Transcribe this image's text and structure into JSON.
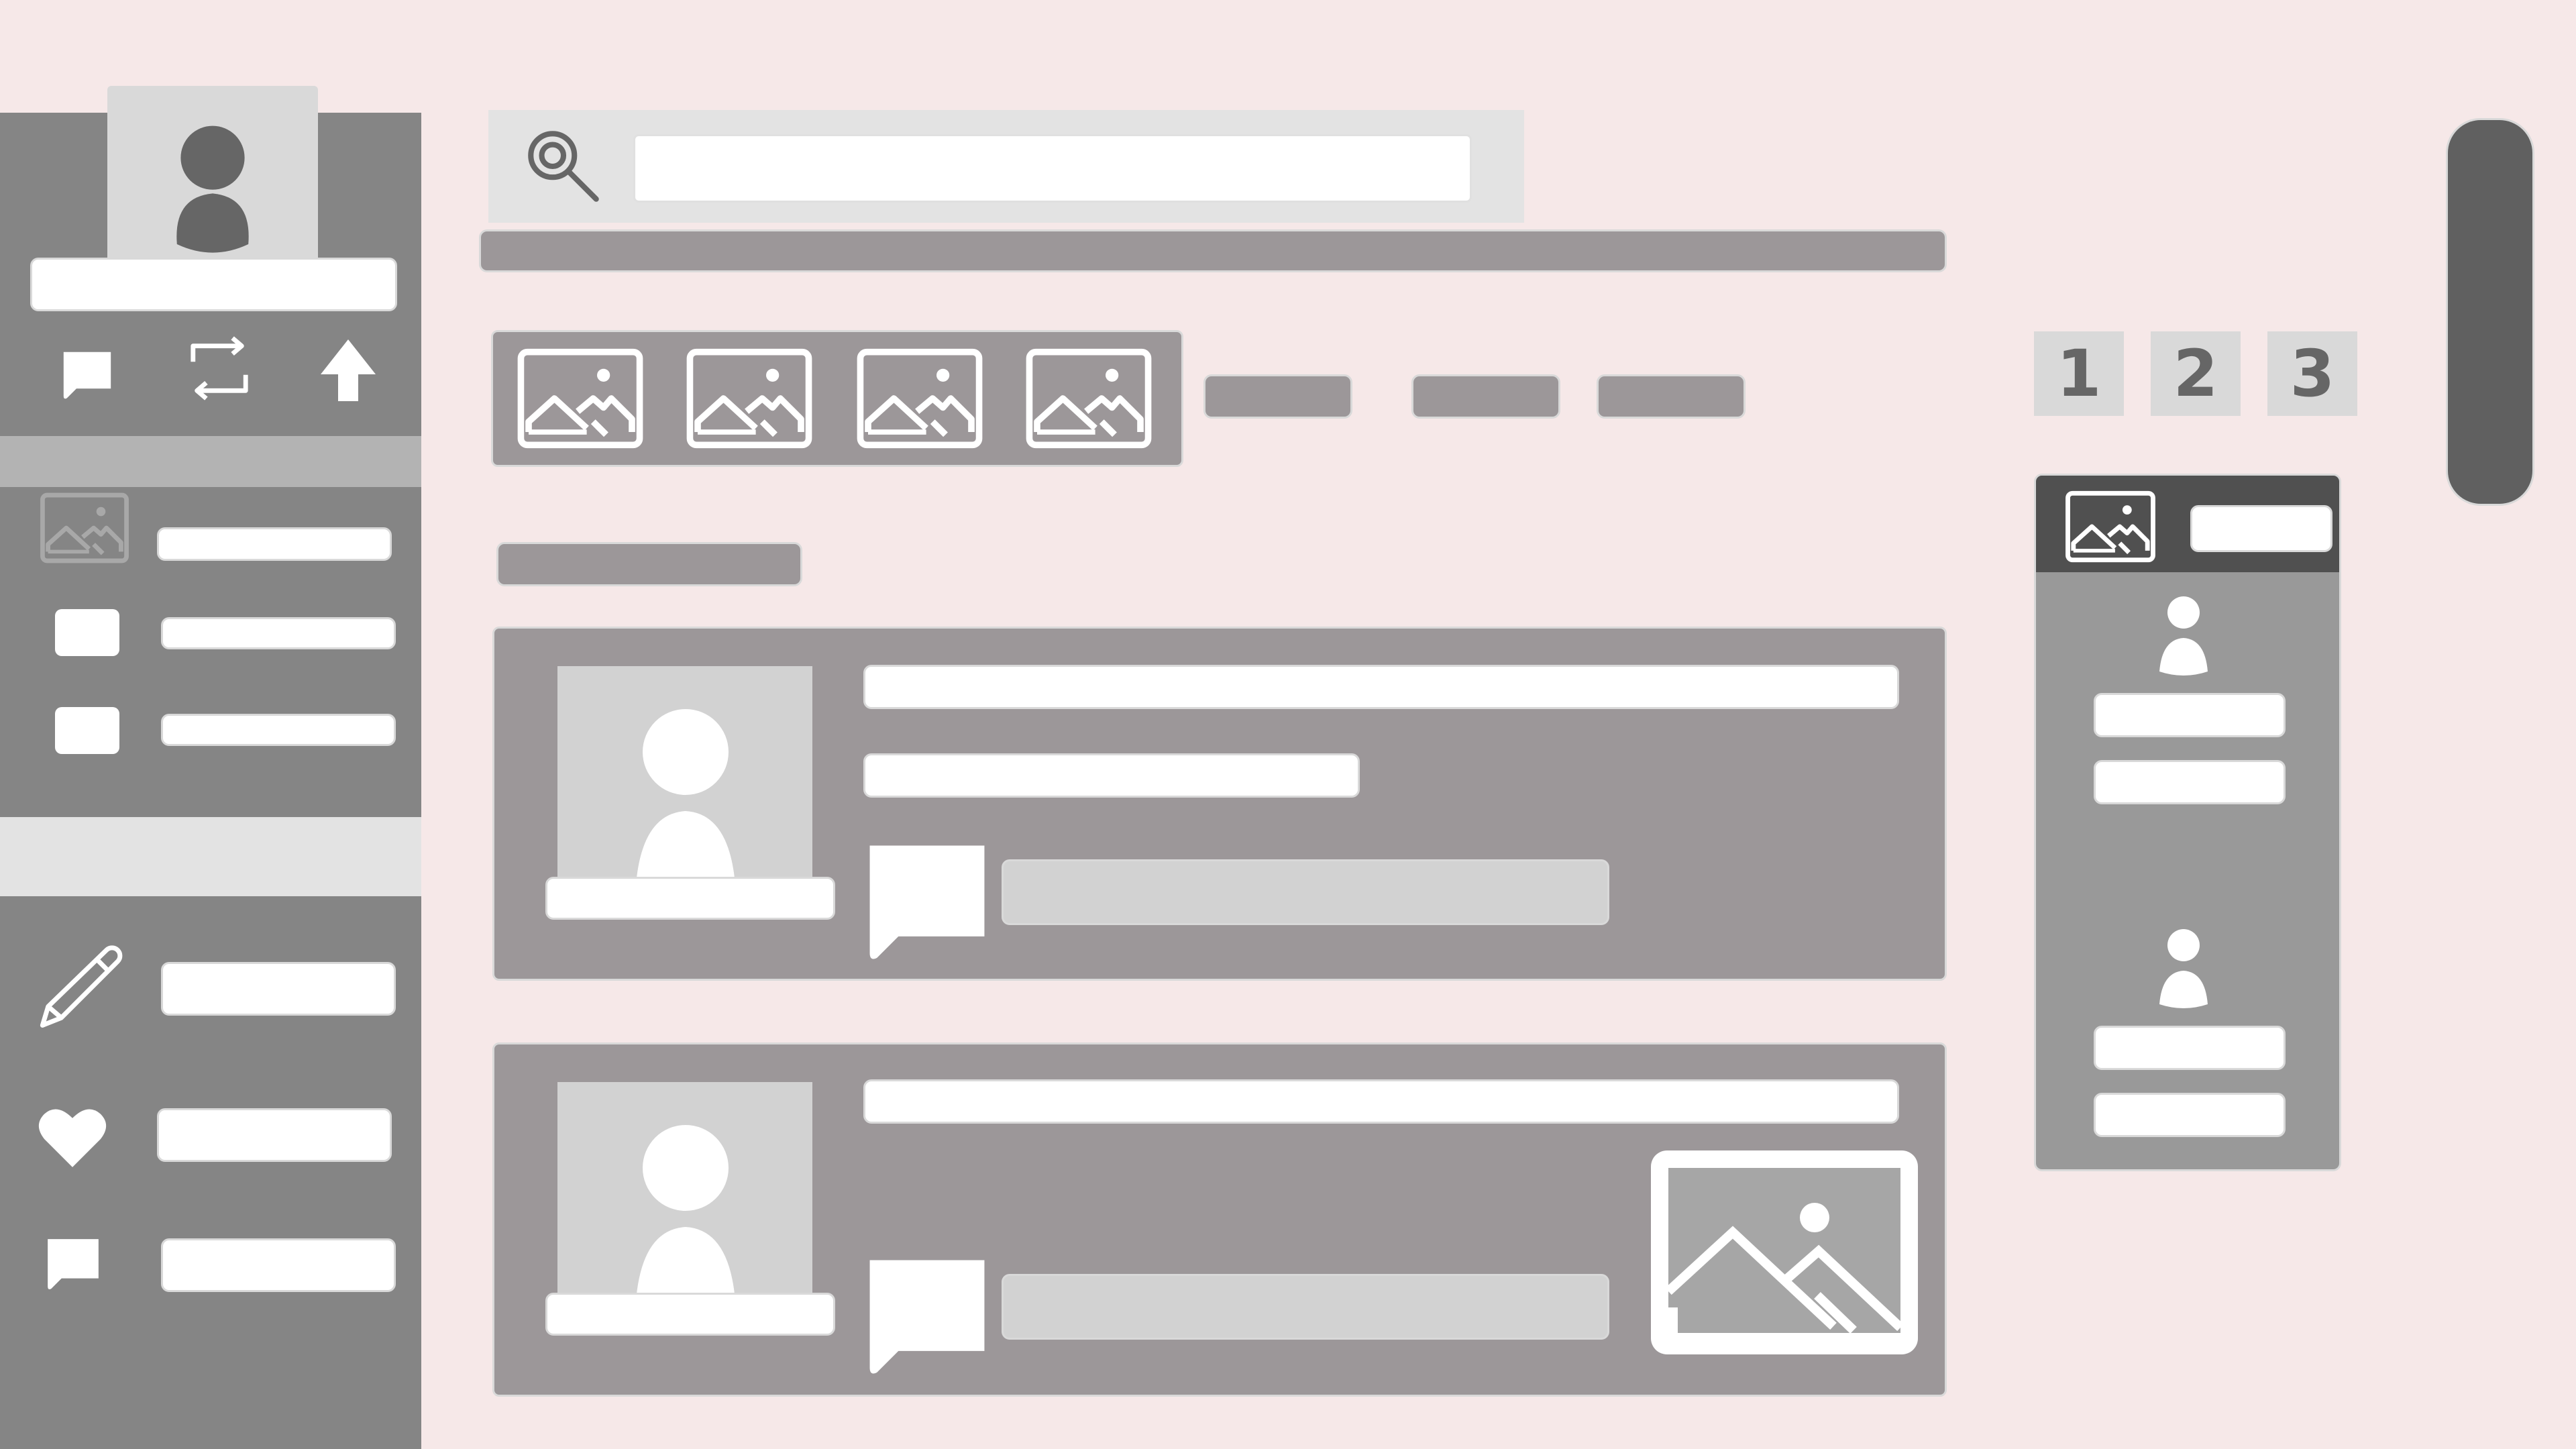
{
  "colors": {
    "page_bg": "#f6e8e8",
    "sidebar_bg": "#858585",
    "card_bg": "#9c9799",
    "panel_dark": "#505050",
    "scrollbar": "#606060",
    "placeholder_white": "#ffffff",
    "placeholder_light": "#d2d2d2"
  },
  "sidebar": {
    "profile": {
      "icon": "user-icon"
    },
    "action_icons": [
      "comment-icon",
      "repost-icon",
      "upload-arrow-icon"
    ],
    "nav_items": [
      {
        "icon": "image-icon"
      },
      {
        "icon": "square-icon"
      },
      {
        "icon": "square-icon"
      }
    ],
    "menu_items": [
      {
        "icon": "pencil-icon"
      },
      {
        "icon": "heart-icon"
      },
      {
        "icon": "comment-icon"
      }
    ]
  },
  "search": {
    "icon": "search-icon",
    "value": "",
    "placeholder": ""
  },
  "gallery": {
    "thumbnails": 4,
    "icon": "image-icon"
  },
  "pagination": {
    "pages": [
      "1",
      "2",
      "3"
    ]
  },
  "feed": {
    "posts": [
      {
        "avatar_icon": "user-icon",
        "comment_icon": "comment-icon",
        "has_image": false
      },
      {
        "avatar_icon": "user-icon",
        "comment_icon": "comment-icon",
        "has_image": true,
        "image_icon": "image-icon"
      }
    ]
  },
  "side_panel": {
    "header_icon": "image-icon",
    "users": [
      {
        "icon": "user-icon"
      },
      {
        "icon": "user-icon"
      }
    ]
  }
}
